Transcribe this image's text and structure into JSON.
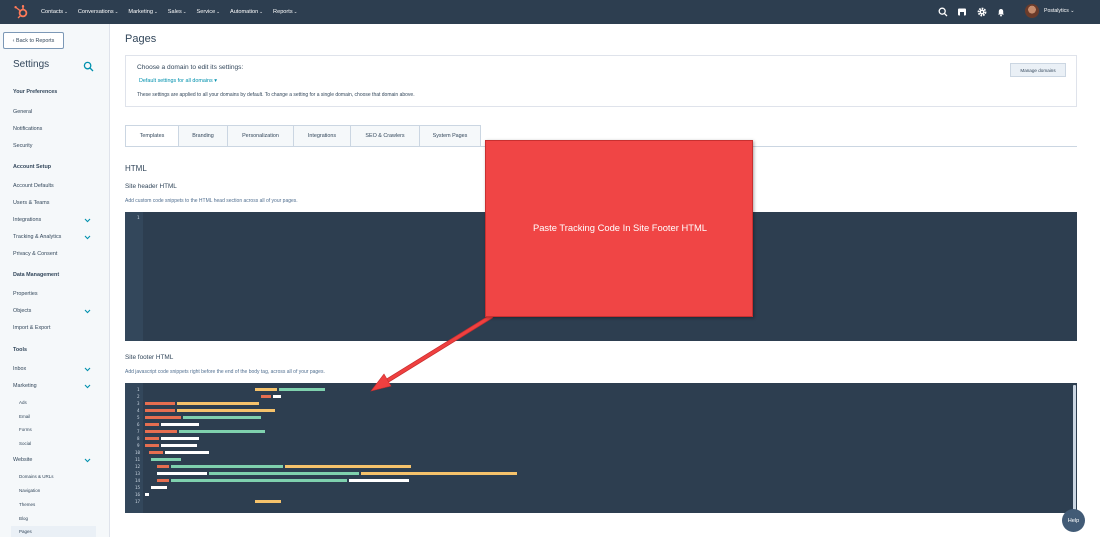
{
  "topnav": {
    "items": [
      "Contacts",
      "Conversations",
      "Marketing",
      "Sales",
      "Service",
      "Automation",
      "Reports"
    ],
    "account": "Postalytics"
  },
  "sidebar": {
    "back_label": "Back to Reports",
    "title": "Settings",
    "your_preferences": "Your Preferences",
    "general": "General",
    "notifications": "Notifications",
    "security": "Security",
    "account_setup": "Account Setup",
    "account_defaults": "Account Defaults",
    "users_teams": "Users & Teams",
    "integrations": "Integrations",
    "tracking_analytics": "Tracking & Analytics",
    "privacy_consent": "Privacy & Consent",
    "data_management": "Data Management",
    "properties": "Properties",
    "objects": "Objects",
    "import_export": "Import & Export",
    "tools": "Tools",
    "inbox": "Inbox",
    "marketing": "Marketing",
    "ads": "Ads",
    "email": "Email",
    "forms": "Forms",
    "social": "Social",
    "website": "Website",
    "domains_urls": "Domains & URLs",
    "navigation": "Navigation",
    "themes": "Themes",
    "blog": "Blog",
    "pages": "Pages"
  },
  "main": {
    "title": "Pages",
    "domain": {
      "heading": "Choose a domain to edit its settings:",
      "selected": "Default settings for all domains",
      "description": "These settings are applied to all your domains by default. To change a setting for a single domain, choose that domain above.",
      "manage_label": "Manage domains"
    },
    "tabs": [
      "Templates",
      "Branding",
      "Personalization",
      "Integrations",
      "SEO & Crawlers",
      "System Pages"
    ],
    "section_title": "HTML",
    "header_label": "Site header HTML",
    "header_help": "Add custom code snippets to the HTML head section across all of your pages.",
    "footer_label": "Site footer HTML",
    "footer_help": "Add javascript code snippets right before the end of the body tag, across all of your pages."
  },
  "callout_text": "Paste Tracking Code In Site Footer HTML",
  "help_label": "Help"
}
